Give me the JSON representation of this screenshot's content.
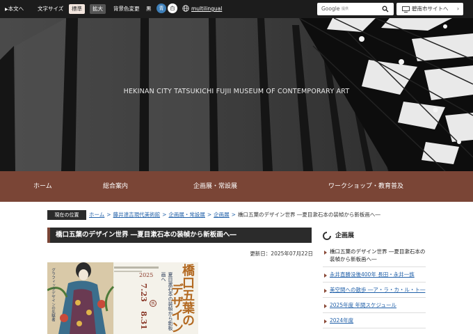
{
  "topbar": {
    "skip_label": "本文へ",
    "font_size_label": "文字サイズ",
    "font_standard": "標準",
    "font_large": "拡大",
    "bg_label": "背景色変更",
    "bg_black": "黒",
    "bg_blue": "青",
    "bg_white": "白",
    "multilingual": "multilingual",
    "search_brand": "Google",
    "search_placeholder": "提供",
    "city_site": "碧南市サイトへ"
  },
  "hero": {
    "title": "HEKINAN CITY TATSUKICHI FUJII MUSEUM OF CONTEMPORARY ART"
  },
  "nav": {
    "items": [
      "ホーム",
      "総合案内",
      "企画展・常設展",
      "ワークショップ・教育普及"
    ]
  },
  "breadcrumb": {
    "label": "現在の位置",
    "links": [
      "ホーム",
      "藤井達吉現代美術館",
      "企画展・常設展",
      "企画展"
    ],
    "current": "橋口五葉のデザイン世界 ―夏目漱石本の装幀から新板画へ―"
  },
  "main": {
    "title": "橋口五葉のデザイン世界 ―夏目漱石本の装幀から新板画へ―",
    "updated": "更新日：2025年07月22日"
  },
  "poster": {
    "side_text": "グラフィックデザインの先駆者",
    "year": "2025",
    "date_start": "7.23",
    "day_start": "水",
    "date_end": "8.31",
    "title_line1": "橋口五葉の",
    "title_line2": "デザイン",
    "subtitle": "夏目漱石本の装幀から新板画へ"
  },
  "sidebar": {
    "heading": "企画展",
    "items": [
      "橋口五葉のデザイン世界 ―夏目漱石本の装幀から新板画へ―",
      "永井直勝没後400年 長田・永井一族",
      "美空間への散歩 ―ア・ラ・カ・ル・ト―",
      "2025年度 年間スケジュール",
      "2024年度"
    ]
  },
  "colors": {
    "nav_brown": "#7a4536",
    "topbar": "#1c1c1c",
    "link_blue": "#1f5fa8",
    "bg_blue_button": "#3e7fb8"
  }
}
